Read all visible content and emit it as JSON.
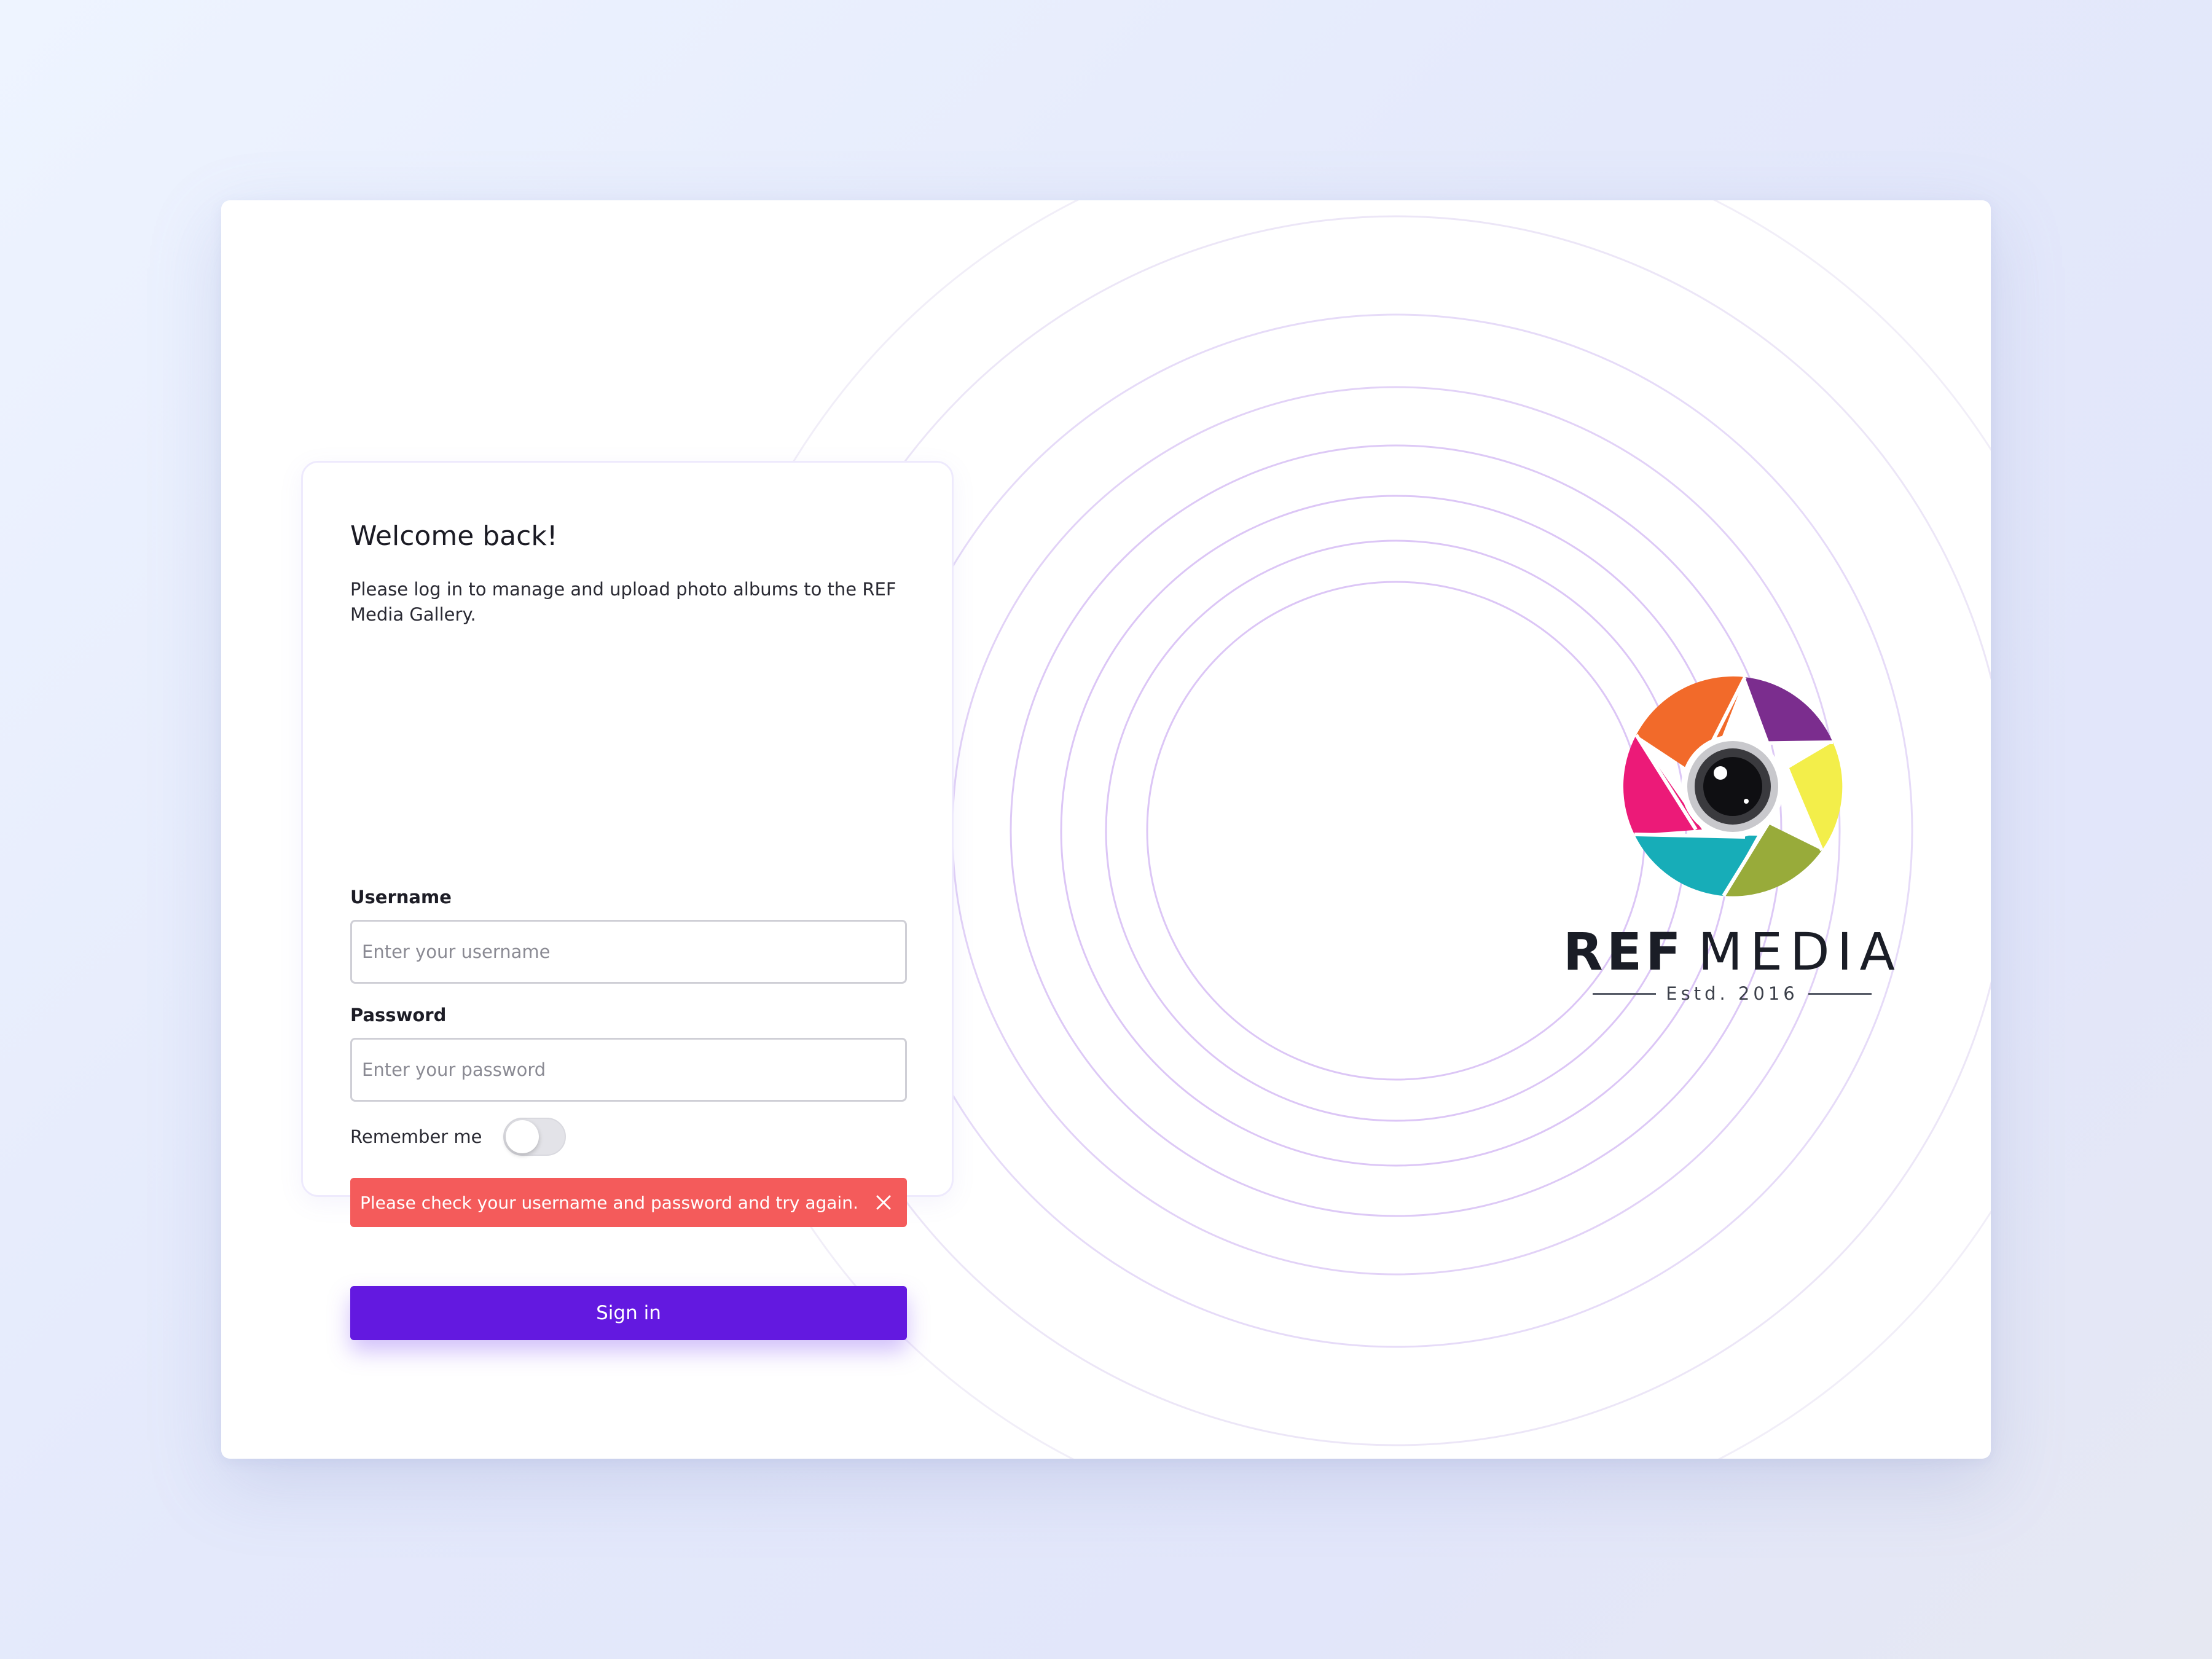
{
  "login": {
    "title": "Welcome back!",
    "subtitle": "Please log in to manage and upload photo albums to the REF Media Gallery.",
    "username": {
      "label": "Username",
      "placeholder": "Enter your username",
      "value": ""
    },
    "password": {
      "label": "Password",
      "placeholder": "Enter your password",
      "value": ""
    },
    "remember": {
      "label": "Remember me",
      "checked": false
    },
    "error": {
      "message": "Please check your username and password and try again.",
      "close_icon": "close-icon"
    },
    "submit_label": "Sign in"
  },
  "brand": {
    "name_bold": "REF",
    "name_light": "MEDIA",
    "established": "Estd. 2016",
    "logo_icon": "camera-aperture-icon",
    "logo_colors": [
      "#7b2d8e",
      "#f0edb0",
      "#f3ee4a",
      "#98ab3a",
      "#17adb8",
      "#ec1a78",
      "#f26a2a"
    ]
  },
  "theme": {
    "accent": "#6319e0",
    "error": "#f45b5b",
    "ring": "#d8c2f5"
  }
}
